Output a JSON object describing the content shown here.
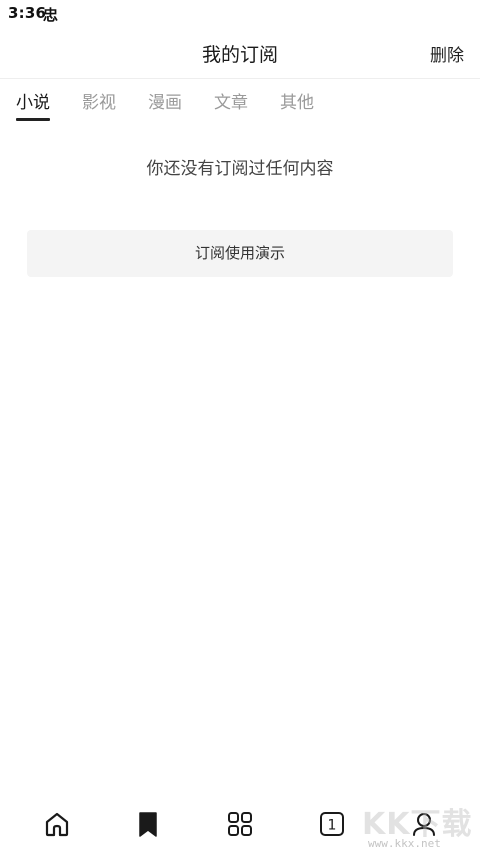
{
  "status_bar": {
    "time": "3:36",
    "app_icon_glyph": "忠"
  },
  "header": {
    "title": "我的订阅",
    "delete_label": "删除"
  },
  "tabs": [
    {
      "label": "小说",
      "active": true
    },
    {
      "label": "影视",
      "active": false
    },
    {
      "label": "漫画",
      "active": false
    },
    {
      "label": "文章",
      "active": false
    },
    {
      "label": "其他",
      "active": false
    }
  ],
  "main": {
    "empty_message": "你还没有订阅过任何内容",
    "demo_button_label": "订阅使用演示"
  },
  "bottom_nav": {
    "items": [
      {
        "icon": "home-icon"
      },
      {
        "icon": "bookmark-icon",
        "active": true
      },
      {
        "icon": "grid-icon"
      },
      {
        "icon": "tab-count-icon",
        "count": "1"
      },
      {
        "icon": "profile-icon"
      }
    ]
  },
  "watermark": {
    "text": "KK下载",
    "url": "www.kkx.net"
  }
}
